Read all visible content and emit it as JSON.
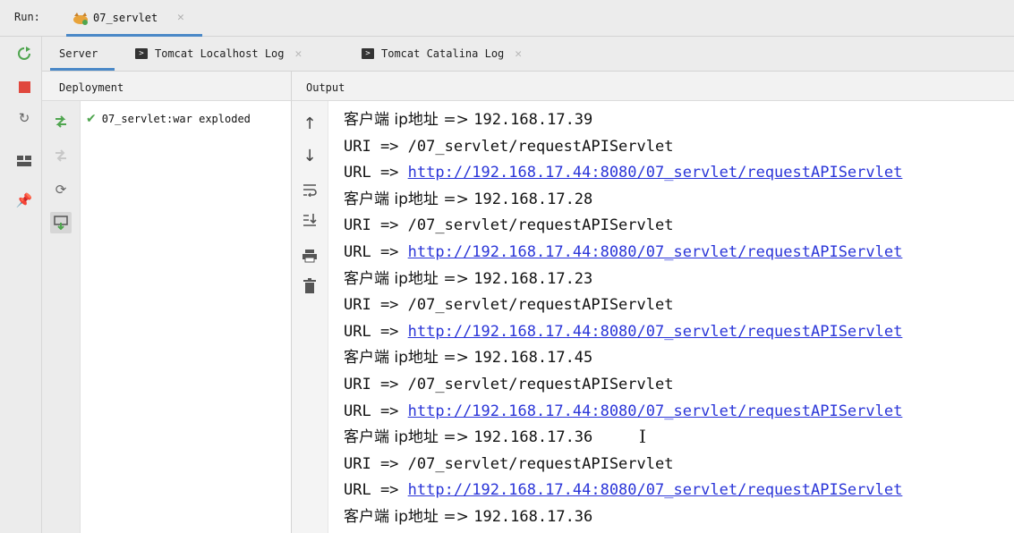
{
  "run_bar": {
    "label": "Run:",
    "tab_label": "07_servlet"
  },
  "sub_tabs": [
    {
      "label": "Server"
    },
    {
      "label": "Tomcat Localhost Log"
    },
    {
      "label": "Tomcat Catalina Log"
    }
  ],
  "deployment": {
    "header": "Deployment",
    "items": [
      {
        "label": "07_servlet:war exploded",
        "status": "deployed"
      }
    ]
  },
  "output": {
    "header": "Output",
    "lines": [
      {
        "prefix": "客户端 ip地址 => ",
        "value": "192.168.17.39"
      },
      {
        "prefix": "URI => ",
        "value": "/07_servlet/requestAPIServlet"
      },
      {
        "prefix": "URL => ",
        "link": "http://192.168.17.44:8080/07_servlet/requestAPIServlet"
      },
      {
        "prefix": "客户端 ip地址 => ",
        "value": "192.168.17.28"
      },
      {
        "prefix": "URI => ",
        "value": "/07_servlet/requestAPIServlet"
      },
      {
        "prefix": "URL => ",
        "link": "http://192.168.17.44:8080/07_servlet/requestAPIServlet"
      },
      {
        "prefix": "客户端 ip地址 => ",
        "value": "192.168.17.23"
      },
      {
        "prefix": "URI => ",
        "value": "/07_servlet/requestAPIServlet"
      },
      {
        "prefix": "URL => ",
        "link": "http://192.168.17.44:8080/07_servlet/requestAPIServlet"
      },
      {
        "prefix": "客户端 ip地址 => ",
        "value": "192.168.17.45"
      },
      {
        "prefix": "URI => ",
        "value": "/07_servlet/requestAPIServlet"
      },
      {
        "prefix": "URL => ",
        "link": "http://192.168.17.44:8080/07_servlet/requestAPIServlet"
      },
      {
        "prefix": "客户端 ip地址 => ",
        "value": "192.168.17.36"
      },
      {
        "prefix": "URI => ",
        "value": "/07_servlet/requestAPIServlet"
      },
      {
        "prefix": "URL => ",
        "link": "http://192.168.17.44:8080/07_servlet/requestAPIServlet"
      },
      {
        "prefix": "客户端 ip地址 => ",
        "value": "192.168.17.36"
      }
    ]
  },
  "colors": {
    "accent": "#4a88c7",
    "link": "#2a35d8",
    "success": "#4fa54f",
    "stop": "#e0473d"
  },
  "icons": [
    "rerun-icon",
    "stop-icon",
    "refresh-icon",
    "layout-icon",
    "pin-icon",
    "deploy-icon",
    "undeploy-icon",
    "update-icon",
    "redeploy-icon",
    "scroll-up-icon",
    "scroll-down-icon",
    "soft-wrap-icon",
    "scroll-to-end-icon",
    "print-icon",
    "clear-icon"
  ]
}
